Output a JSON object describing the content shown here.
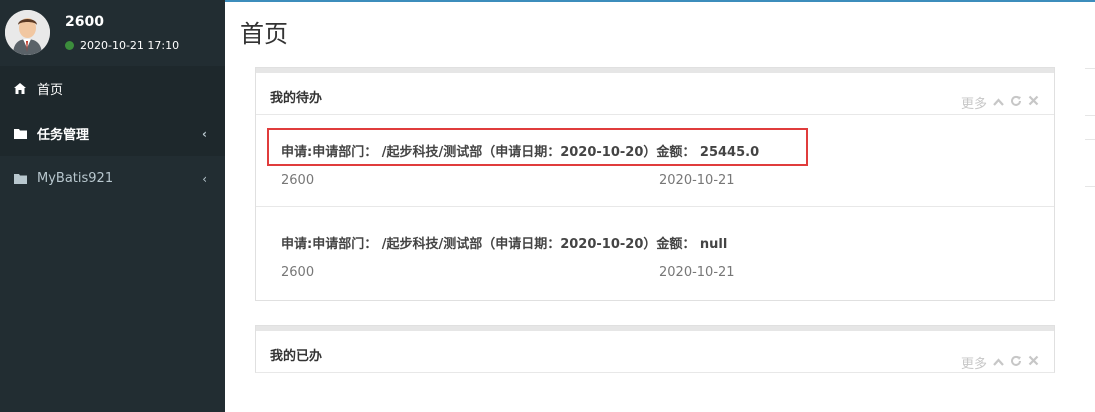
{
  "user": {
    "name": "2600",
    "datetime": "2020-10-21 17:10"
  },
  "sidebar": {
    "items": [
      {
        "label": "首页",
        "icon": "home-icon"
      },
      {
        "label": "任务管理",
        "icon": "folder-icon"
      },
      {
        "label": "MyBatis921",
        "icon": "folder-icon"
      }
    ]
  },
  "page": {
    "title": "首页"
  },
  "todo_box": {
    "title": "我的待办",
    "more": "更多",
    "items": [
      {
        "title": "申请:申请部门：  /起步科技/测试部（申请日期：2020-10-20）金额：  25445.0",
        "user": "2600",
        "date": "2020-10-21"
      },
      {
        "title": "申请:申请部门：  /起步科技/测试部（申请日期：2020-10-20）金额：  null",
        "user": "2600",
        "date": "2020-10-21"
      }
    ]
  },
  "done_box": {
    "title": "我的已办",
    "more": "更多"
  },
  "colors": {
    "sidebar_bg": "#222d32",
    "highlight": "#e03c3c",
    "status": "#3c8d3c"
  }
}
